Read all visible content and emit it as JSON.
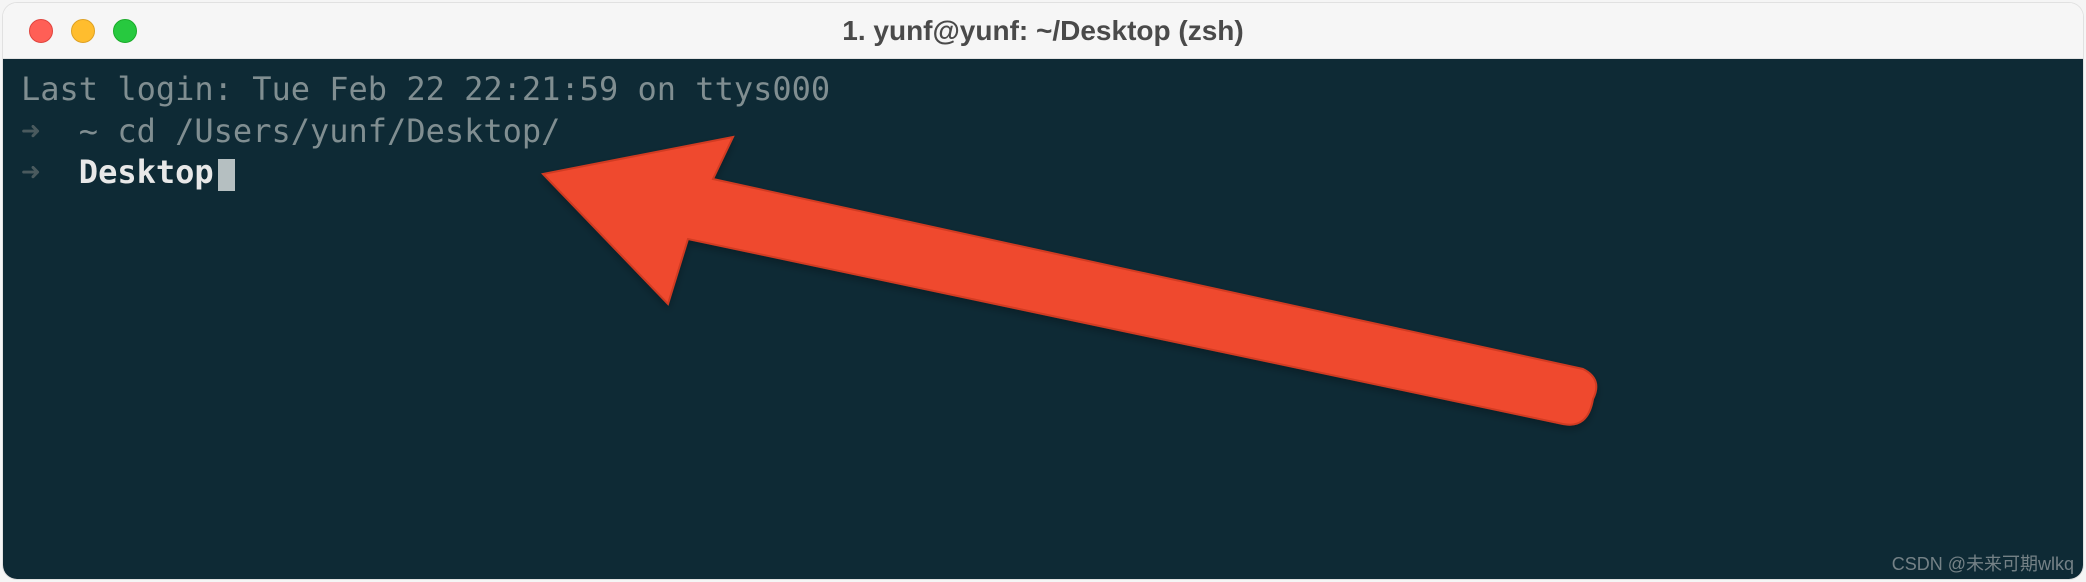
{
  "window": {
    "title": "1. yunf@yunf: ~/Desktop (zsh)"
  },
  "terminal": {
    "last_login": "Last login: Tue Feb 22 22:21:59 on ttys000",
    "line1": {
      "arrow": "➜",
      "context": "~",
      "command": "cd /Users/yunf/Desktop/"
    },
    "line2": {
      "arrow": "➜",
      "context": "Desktop"
    }
  },
  "watermark": "CSDN @未来可期wlkq"
}
